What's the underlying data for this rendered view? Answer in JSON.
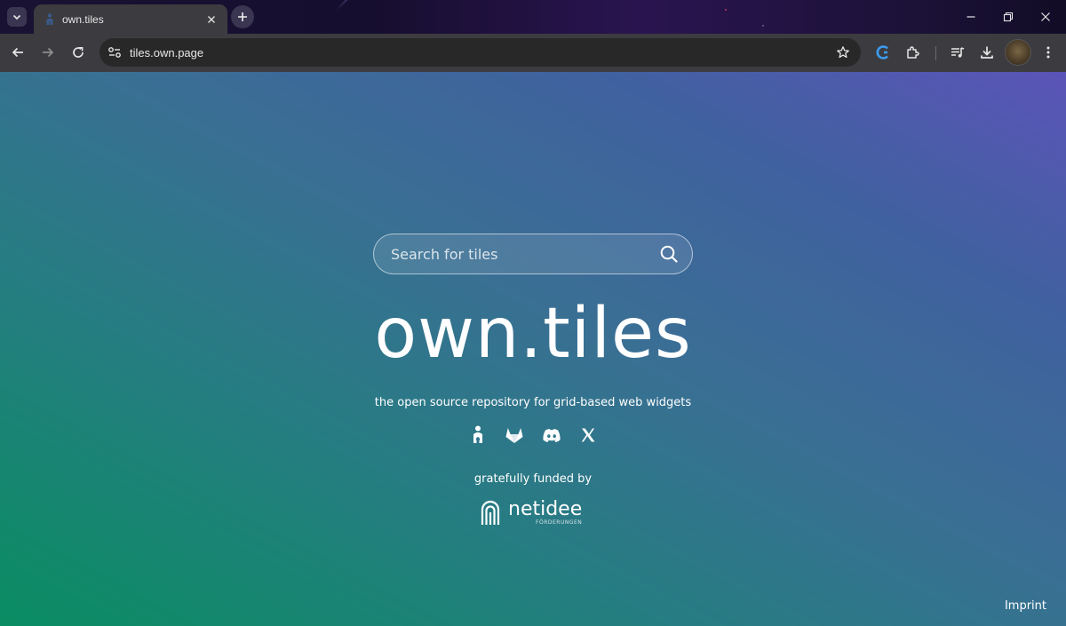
{
  "browser": {
    "tab": {
      "title": "own.tiles",
      "favicon": "own-tiles-favicon"
    },
    "address_bar": {
      "url": "tiles.own.page"
    }
  },
  "page": {
    "search": {
      "placeholder": "Search for tiles"
    },
    "hero_title": "own.tiles",
    "tagline": "the open source repository for grid-based web widgets",
    "socials": [
      "opencollective-icon",
      "gitlab-icon",
      "discord-icon",
      "x-icon"
    ],
    "funded_label": "gratefully funded by",
    "sponsor": {
      "name": "netidee",
      "subtitle": "FÖRDERUNGEN"
    },
    "imprint_label": "Imprint"
  },
  "colors": {
    "page_gradient_top": "#5b54b8",
    "page_gradient_bottom": "#0a8d62",
    "chrome_toolbar": "#3c3c40"
  }
}
